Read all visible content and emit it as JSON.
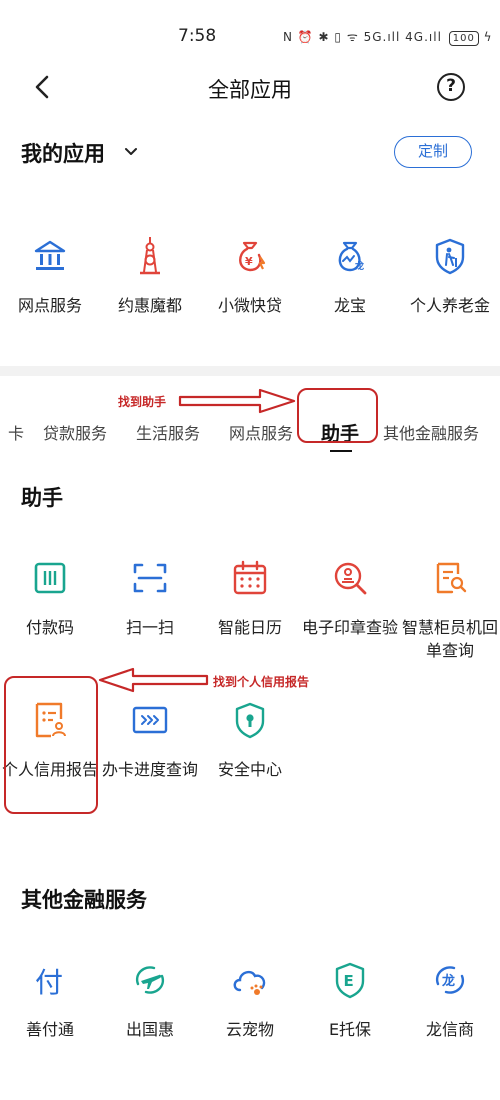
{
  "status_bar": {
    "time": "7:58",
    "icons_text": "N ⏰ ✱ ▯ ᯤ 5G.ıll 4G.ıll",
    "battery": "100"
  },
  "header": {
    "back_icon": "chevron-left-icon",
    "title": "全部应用",
    "help_icon": "question-circle-icon"
  },
  "my_apps": {
    "title": "我的应用",
    "customize_label": "定制",
    "items": [
      {
        "label": "网点服务",
        "icon": "bank-branch-icon"
      },
      {
        "label": "约惠魔都",
        "icon": "tower-icon"
      },
      {
        "label": "小微快贷",
        "icon": "money-bag-yen-icon"
      },
      {
        "label": "龙宝",
        "icon": "dragon-bag-icon"
      },
      {
        "label": "个人养老金",
        "icon": "pension-icon"
      }
    ]
  },
  "tabs": [
    {
      "label": "卡",
      "active": false
    },
    {
      "label": "贷款服务",
      "active": false
    },
    {
      "label": "生活服务",
      "active": false
    },
    {
      "label": "网点服务",
      "active": false
    },
    {
      "label": "助手",
      "active": true
    },
    {
      "label": "其他金融服务",
      "active": false
    }
  ],
  "assistant": {
    "title": "助手",
    "items": [
      {
        "label": "付款码",
        "icon": "payment-code-icon"
      },
      {
        "label": "扫一扫",
        "icon": "scan-icon"
      },
      {
        "label": "智能日历",
        "icon": "calendar-icon"
      },
      {
        "label": "电子印章查验",
        "icon": "seal-search-icon"
      },
      {
        "label": "智慧柜员机回单查询",
        "icon": "receipt-search-icon"
      },
      {
        "label": "个人信用报告",
        "icon": "credit-report-icon"
      },
      {
        "label": "办卡进度查询",
        "icon": "card-progress-icon"
      },
      {
        "label": "安全中心",
        "icon": "security-shield-icon"
      }
    ]
  },
  "other_finance": {
    "title": "其他金融服务",
    "items": [
      {
        "label": "善付通",
        "icon": "fu-character-icon"
      },
      {
        "label": "出国惠",
        "icon": "airplane-icon"
      },
      {
        "label": "云宠物",
        "icon": "cloud-paw-icon"
      },
      {
        "label": "E托保",
        "icon": "e-shield-icon"
      },
      {
        "label": "龙信商",
        "icon": "dragon-coin-icon"
      }
    ]
  },
  "annotations": {
    "find_assistant": "找到助手",
    "find_credit_report": "找到个人信用报告"
  },
  "colors": {
    "blue": "#2b6fd6",
    "red": "#e0443a",
    "orange": "#f07a2a",
    "teal": "#19a58f",
    "annotation_red": "#c62828"
  }
}
